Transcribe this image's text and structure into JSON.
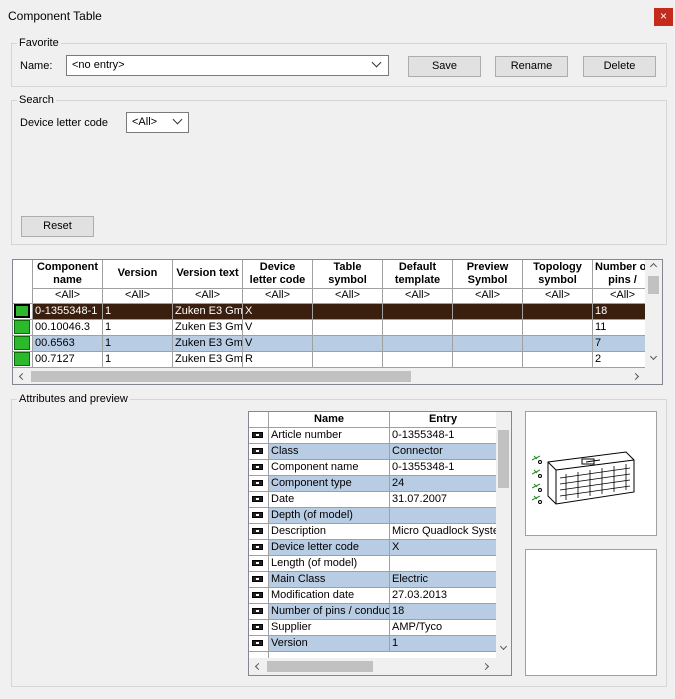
{
  "window": {
    "title": "Component Table",
    "close_glyph": "×"
  },
  "favorite": {
    "group_label": "Favorite",
    "name_label": "Name:",
    "name_value": "<no entry>",
    "save_label": "Save",
    "rename_label": "Rename",
    "delete_label": "Delete"
  },
  "search": {
    "group_label": "Search",
    "device_letter_label": "Device letter code",
    "device_letter_value": "<All>",
    "reset_label": "Reset"
  },
  "table": {
    "columns": [
      {
        "line1": "Component",
        "line2": "name",
        "filter": "<All>"
      },
      {
        "line1": "Version",
        "line2": "",
        "filter": "<All>"
      },
      {
        "line1": "Version text",
        "line2": "",
        "filter": "<All>"
      },
      {
        "line1": "Device",
        "line2": "letter code",
        "filter": "<All>"
      },
      {
        "line1": "Table",
        "line2": "symbol",
        "filter": "<All>"
      },
      {
        "line1": "Default",
        "line2": "template",
        "filter": "<All>"
      },
      {
        "line1": "Preview",
        "line2": "Symbol",
        "filter": "<All>"
      },
      {
        "line1": "Topology",
        "line2": "symbol",
        "filter": "<All>"
      },
      {
        "line1": "Number of",
        "line2": "pins /",
        "filter": "<All>"
      }
    ],
    "rows": [
      {
        "cells": [
          "0-1355348-1",
          "1",
          "Zuken E3 Gm",
          "X",
          "",
          "",
          "",
          "",
          "18"
        ],
        "selected": true
      },
      {
        "cells": [
          "00.10046.3",
          "1",
          "Zuken E3 Gm",
          "V",
          "",
          "",
          "",
          "",
          "11"
        ]
      },
      {
        "cells": [
          "00.6563",
          "1",
          "Zuken E3 Gm",
          "V",
          "",
          "",
          "",
          "",
          "7"
        ]
      },
      {
        "cells": [
          "00.7127",
          "1",
          "Zuken E3 Gm",
          "R",
          "",
          "",
          "",
          "",
          "2"
        ]
      }
    ]
  },
  "attributes": {
    "group_label": "Attributes and preview",
    "headers": {
      "name": "Name",
      "entry": "Entry"
    },
    "rows": [
      {
        "name": "Article number",
        "entry": "0-1355348-1"
      },
      {
        "name": "Class",
        "entry": "Connector"
      },
      {
        "name": "Component name",
        "entry": "0-1355348-1"
      },
      {
        "name": "Component type",
        "entry": "24"
      },
      {
        "name": "Date",
        "entry": "31.07.2007"
      },
      {
        "name": "Depth (of model)",
        "entry": ""
      },
      {
        "name": "Description",
        "entry": "Micro Quadlock Syste"
      },
      {
        "name": "Device letter code",
        "entry": "X"
      },
      {
        "name": "Length (of model)",
        "entry": ""
      },
      {
        "name": "Main Class",
        "entry": "Electric"
      },
      {
        "name": "Modification date",
        "entry": "27.03.2013"
      },
      {
        "name": "Number of pins / conduc",
        "entry": "18"
      },
      {
        "name": "Supplier",
        "entry": "AMP/Tyco"
      },
      {
        "name": "Version",
        "entry": "1"
      }
    ]
  },
  "colors": {
    "selected_row": "#3b1f0e",
    "alt_row": "#b8cde4",
    "accent": "#c42b1c",
    "row_icon": "#2db82d"
  },
  "icons": {
    "row_status": "component-status-icon",
    "attribute_row": "attribute-row-icon",
    "preview": "connector-preview-image"
  }
}
